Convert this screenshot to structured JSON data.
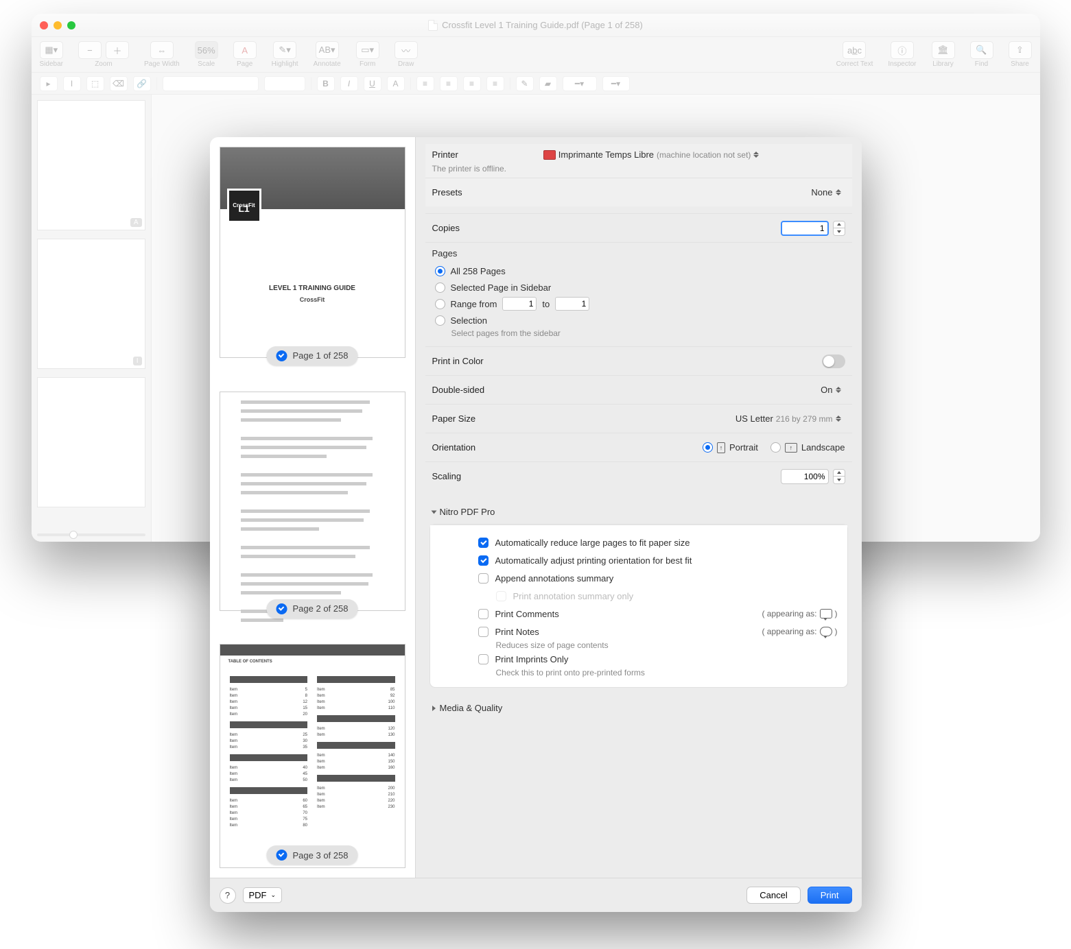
{
  "window": {
    "title": "Crossfit Level 1 Training Guide.pdf (Page 1 of 258)"
  },
  "toolbar": {
    "sidebar": "Sidebar",
    "zoom": "Zoom",
    "page_width": "Page Width",
    "scale": "Scale",
    "scale_value": "56%",
    "page": "Page",
    "highlight": "Highlight",
    "annotate": "Annotate",
    "form": "Form",
    "draw": "Draw",
    "correct": "Correct Text",
    "inspector": "Inspector",
    "library": "Library",
    "find": "Find",
    "share": "Share"
  },
  "sidebar_thumbs": {
    "badge1": "A",
    "badge2": "I"
  },
  "preview": {
    "logo": "L1",
    "crossfit": "CrossFit",
    "guide_title": "LEVEL 1 TRAINING GUIDE",
    "brand": "CrossFit",
    "page1": "Page 1 of 258",
    "page2": "Page 2 of 258",
    "page3": "Page 3 of 258",
    "toc_header": "TABLE OF CONTENTS"
  },
  "print": {
    "printer_label": "Printer",
    "printer_name": "Imprimante Temps Libre",
    "printer_note": "(machine location not set)",
    "printer_offline": "The printer is offline.",
    "presets_label": "Presets",
    "presets_value": "None",
    "copies_label": "Copies",
    "copies_value": "1",
    "pages": {
      "label": "Pages",
      "all": "All 258 Pages",
      "selected_sidebar": "Selected Page in Sidebar",
      "range_from": "Range from",
      "range_to": "to",
      "range_start": "1",
      "range_end": "1",
      "selection": "Selection",
      "selection_hint": "Select pages from the sidebar"
    },
    "color_label": "Print in Color",
    "double_label": "Double-sided",
    "double_value": "On",
    "paper_label": "Paper Size",
    "paper_value": "US Letter",
    "paper_dim": "216 by 279 mm",
    "orient_label": "Orientation",
    "orient_portrait": "Portrait",
    "orient_landscape": "Landscape",
    "scaling_label": "Scaling",
    "scaling_value": "100%",
    "nitro": {
      "section": "Nitro PDF Pro",
      "auto_reduce": "Automatically reduce large pages to fit paper size",
      "auto_orient": "Automatically adjust printing orientation for best fit",
      "append_annot": "Append annotations summary",
      "annot_only": "Print annotation summary only",
      "comments": "Print Comments",
      "notes": "Print Notes",
      "notes_hint": "Reduces size of page contents",
      "imprints": "Print Imprints Only",
      "imprints_hint": "Check this to print onto pre-printed forms",
      "appearing": "( appearing as:",
      "appearing_close": ")"
    },
    "media_quality": "Media & Quality"
  },
  "footer": {
    "help": "?",
    "pdf": "PDF",
    "cancel": "Cancel",
    "print": "Print"
  }
}
